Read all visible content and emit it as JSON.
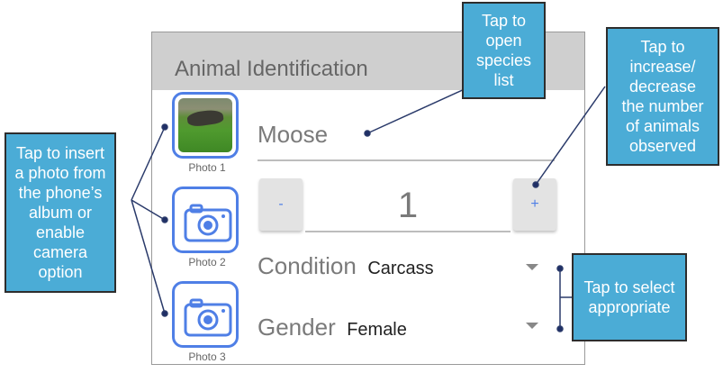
{
  "screen": {
    "title": "Animal Identification",
    "species_value": "Moose",
    "count": {
      "minus_label": "-",
      "value": "1",
      "plus_label": "+"
    },
    "photos": [
      {
        "caption": "Photo 1",
        "state": "image"
      },
      {
        "caption": "Photo 2",
        "state": "camera-icon"
      },
      {
        "caption": "Photo 3",
        "state": "camera-icon"
      }
    ],
    "condition": {
      "label": "Condition",
      "value": "Carcass"
    },
    "gender": {
      "label": "Gender",
      "value": "Female"
    }
  },
  "callouts": {
    "species": [
      "Tap to",
      "open",
      "species",
      "list"
    ],
    "count": [
      "Tap to",
      "increase/",
      "decrease",
      "the number",
      "of animals",
      "observed"
    ],
    "photo": [
      "Tap to insert",
      "a photo from",
      "the phone’s",
      "album or",
      "enable",
      "camera",
      "option"
    ],
    "select": [
      "Tap to select",
      "appropriate"
    ]
  },
  "colors": {
    "accent": "#4f7fe6",
    "callout_fill": "#4bacd6",
    "header_bg": "#cfcfcf"
  }
}
